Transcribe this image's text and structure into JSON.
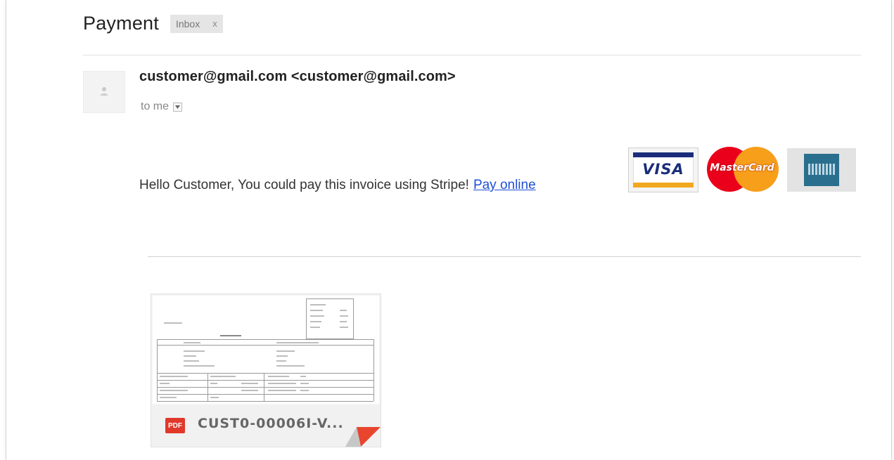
{
  "email": {
    "subject": "Payment",
    "label": {
      "text": "Inbox",
      "remove": "x"
    },
    "sender": "customer@gmail.com <customer@gmail.com>",
    "recipient": "to me",
    "body_text": "Hello Customer, You could pay this invoice using Stripe!",
    "pay_link": "Pay online",
    "cards": [
      {
        "name": "visa",
        "text": "VISA"
      },
      {
        "name": "mastercard",
        "text": "MasterCard"
      },
      {
        "name": "american-express",
        "text": ""
      }
    ],
    "attachment": {
      "type": "PDF",
      "name": "CUST0-00006I-V..."
    }
  },
  "colors": {
    "link": "#1f4fd6",
    "pdf_badge": "#e0392b",
    "visa_blue": "#1a2d7a",
    "visa_gold": "#f2a81d",
    "mc_red": "#eb001b",
    "mc_orange": "#f79e1b",
    "amex_blue": "#2a6f8e"
  }
}
